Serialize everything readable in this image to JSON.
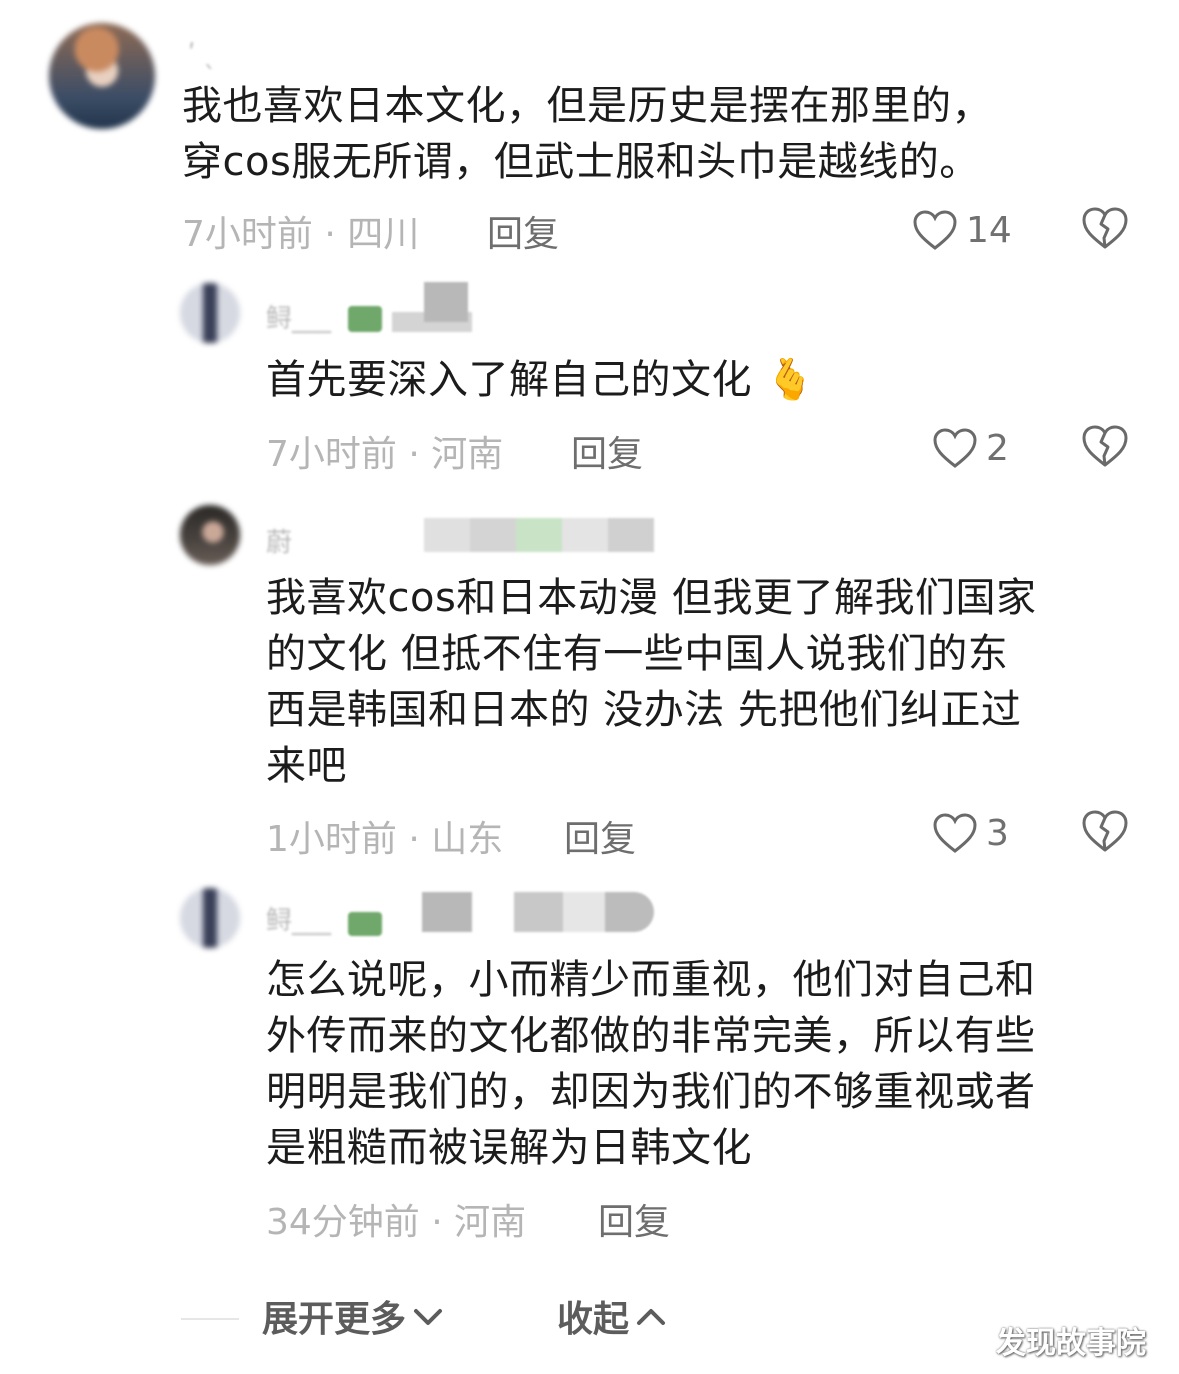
{
  "comments": [
    {
      "username": "ʹ ˎ",
      "lines": [
        "我也喜欢日本文化，但是历史是摆在那里的，",
        "穿cos服无所谓，但武士服和头巾是越线的。"
      ],
      "time_location": "7小时前 · 四川",
      "reply_label": "回复",
      "likes": "14"
    },
    {
      "username": "鲟___",
      "lines": [
        "首先要深入了解自己的文化 🫰"
      ],
      "time_location": "7小时前 · 河南",
      "reply_label": "回复",
      "likes": "2"
    },
    {
      "username": "蔚",
      "lines": [
        "我喜欢cos和日本动漫 但我更了解我们国家",
        "的文化 但抵不住有一些中国人说我们的东",
        "西是韩国和日本的 没办法 先把他们纠正过",
        "来吧"
      ],
      "time_location": "1小时前 · 山东",
      "reply_label": "回复",
      "likes": "3"
    },
    {
      "username": "鲟___",
      "lines": [
        "怎么说呢，小而精少而重视，他们对自己和",
        "外传而来的文化都做的非常完美，所以有些",
        "明明是我们的，却因为我们的不够重视或者",
        "是粗糙而被误解为日韩文化"
      ],
      "time_location": "34分钟前 · 河南",
      "reply_label": "回复"
    }
  ],
  "footer": {
    "expand_label": "展开更多",
    "collapse_label": "收起"
  },
  "watermark": "发现故事院",
  "colors": {
    "text": "#1c1c1c",
    "meta": "#b5b5b5",
    "reply": "#6e6e6e",
    "icon": "#6a6a6a"
  }
}
